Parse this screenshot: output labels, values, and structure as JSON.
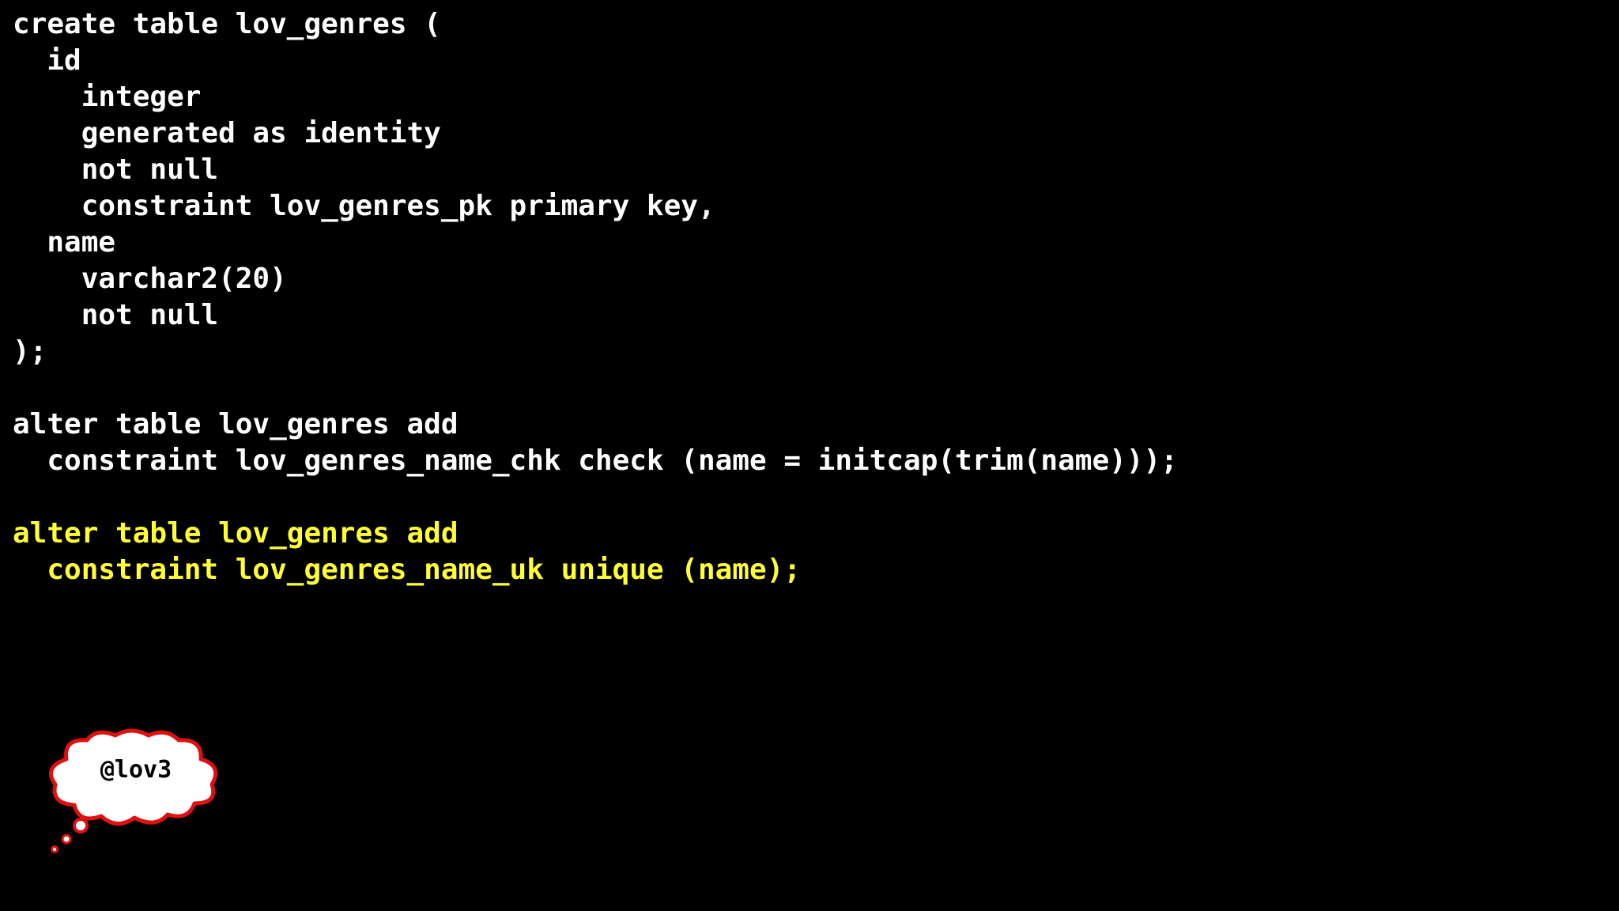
{
  "slide": {
    "code_lines": [
      {
        "text": "create table lov_genres (",
        "highlight": false
      },
      {
        "text": "  id",
        "highlight": false
      },
      {
        "text": "    integer",
        "highlight": false
      },
      {
        "text": "    generated as identity",
        "highlight": false
      },
      {
        "text": "    not null",
        "highlight": false
      },
      {
        "text": "    constraint lov_genres_pk primary key,",
        "highlight": false
      },
      {
        "text": "  name",
        "highlight": false
      },
      {
        "text": "    varchar2(20)",
        "highlight": false
      },
      {
        "text": "    not null",
        "highlight": false
      },
      {
        "text": ");",
        "highlight": false
      },
      {
        "text": "",
        "highlight": false
      },
      {
        "text": "alter table lov_genres add",
        "highlight": false
      },
      {
        "text": "  constraint lov_genres_name_chk check (name = initcap(trim(name)));",
        "highlight": false
      },
      {
        "text": "",
        "highlight": false
      },
      {
        "text": "alter table lov_genres add",
        "highlight": true
      },
      {
        "text": "  constraint lov_genres_name_uk unique (name);",
        "highlight": true
      }
    ],
    "thought_bubble": {
      "handle": "@lov3"
    },
    "colors": {
      "background": "#000000",
      "code_text": "#ffffff",
      "highlight_text": "#ffff33",
      "bubble_fill": "#ffffff",
      "bubble_outline": "#e01010"
    }
  }
}
